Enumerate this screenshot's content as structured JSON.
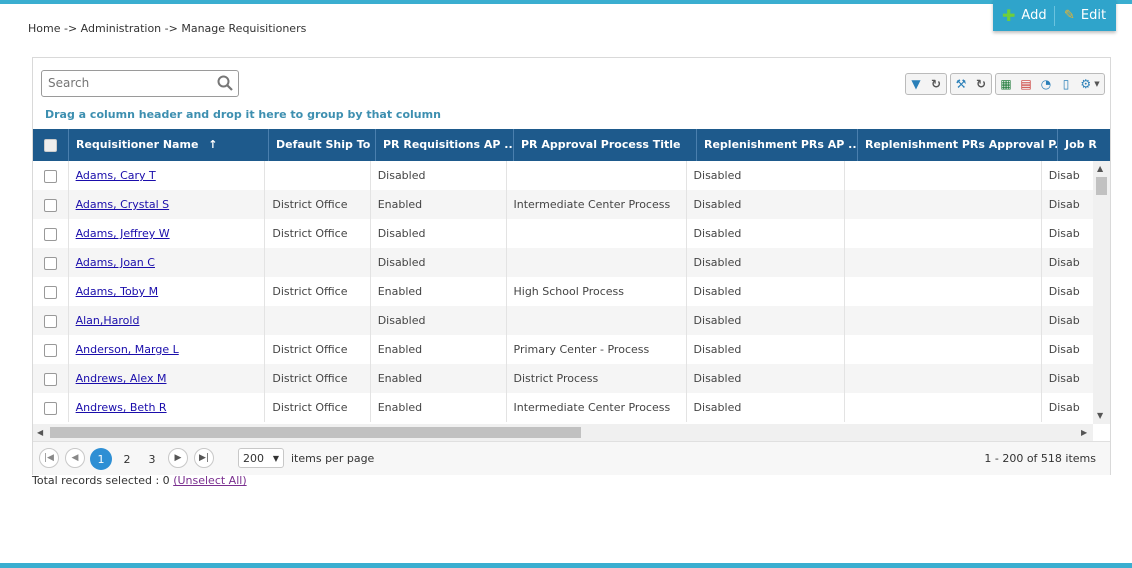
{
  "header": {
    "breadcrumb": "Home -> Administration -> Manage Requisitioners",
    "add_label": "Add",
    "edit_label": "Edit"
  },
  "grid": {
    "search_placeholder": "Search",
    "group_hint": "Drag a column header and drop it here to group by that column",
    "sort_indicator": "↑",
    "columns": [
      "Requisitioner Name",
      "Default Ship To",
      "PR Requisitions AP ...",
      "PR Approval Process Title",
      "Replenishment PRs AP ...",
      "Replenishment PRs Approval P...",
      "Job R"
    ],
    "rows": [
      {
        "name": "Adams, Cary T",
        "ship": "",
        "pr_ap": "Disabled",
        "pr_title": "",
        "rep_ap": "Disabled",
        "rep_title": "",
        "job": "Disab"
      },
      {
        "name": "Adams, Crystal S",
        "ship": "District Office",
        "pr_ap": "Enabled",
        "pr_title": "Intermediate Center Process",
        "rep_ap": "Disabled",
        "rep_title": "",
        "job": "Disab"
      },
      {
        "name": "Adams, Jeffrey W",
        "ship": "District Office",
        "pr_ap": "Disabled",
        "pr_title": "",
        "rep_ap": "Disabled",
        "rep_title": "",
        "job": "Disab"
      },
      {
        "name": "Adams, Joan C",
        "ship": "",
        "pr_ap": "Disabled",
        "pr_title": "",
        "rep_ap": "Disabled",
        "rep_title": "",
        "job": "Disab"
      },
      {
        "name": "Adams, Toby M",
        "ship": "District Office",
        "pr_ap": "Enabled",
        "pr_title": "High School Process",
        "rep_ap": "Disabled",
        "rep_title": "",
        "job": "Disab"
      },
      {
        "name": "Alan,Harold",
        "ship": "",
        "pr_ap": "Disabled",
        "pr_title": "",
        "rep_ap": "Disabled",
        "rep_title": "",
        "job": "Disab"
      },
      {
        "name": "Anderson, Marge L",
        "ship": "District Office",
        "pr_ap": "Enabled",
        "pr_title": "Primary Center - Process",
        "rep_ap": "Disabled",
        "rep_title": "",
        "job": "Disab"
      },
      {
        "name": "Andrews, Alex M",
        "ship": "District Office",
        "pr_ap": "Enabled",
        "pr_title": "District Process",
        "rep_ap": "Disabled",
        "rep_title": "",
        "job": "Disab"
      },
      {
        "name": "Andrews, Beth R",
        "ship": "District Office",
        "pr_ap": "Enabled",
        "pr_title": "Intermediate Center Process",
        "rep_ap": "Disabled",
        "rep_title": "",
        "job": "Disab"
      }
    ]
  },
  "pager": {
    "pages": [
      "1",
      "2",
      "3"
    ],
    "current_page": "1",
    "page_size": "200",
    "per_page_label": "items per page",
    "range": "1 - 200 of 518 items"
  },
  "footer": {
    "selected_text": "Total records selected : 0",
    "unselect_label": "(Unselect All)"
  },
  "toolbar_icons": [
    "filter-icon",
    "refresh-icon",
    "wrench-icon",
    "refresh-icon",
    "excel-icon",
    "pdf-icon",
    "chart-icon",
    "document-icon",
    "gear-icon"
  ],
  "colors": {
    "accent": "#3aaed0",
    "header_bg": "#1e5a8c",
    "link": "#1a0dab",
    "current_page": "#2e8fd4"
  }
}
